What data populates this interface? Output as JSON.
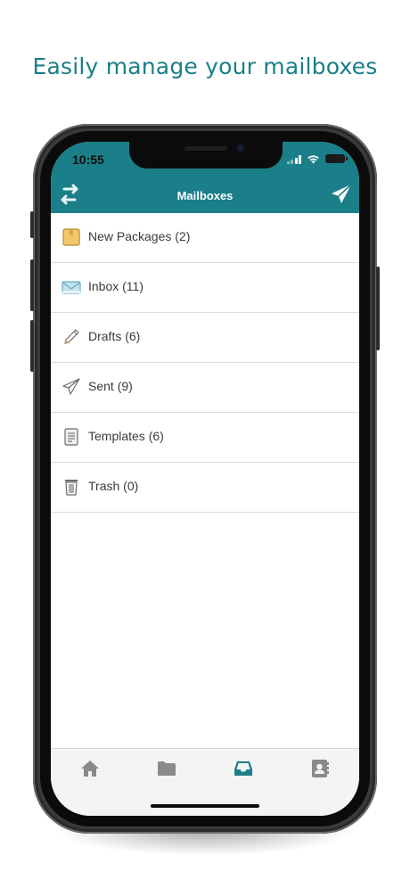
{
  "headline": "Easily manage your mailboxes",
  "status_bar": {
    "time": "10:55"
  },
  "nav": {
    "title": "Mailboxes",
    "left_icon": "switch-arrows-icon",
    "right_icon": "send-paper-plane-icon"
  },
  "mailboxes": [
    {
      "label": "New Packages (2)",
      "icon": "package-icon"
    },
    {
      "label": "Inbox (11)",
      "icon": "inbox-envelope-icon"
    },
    {
      "label": "Drafts (6)",
      "icon": "pencil-icon"
    },
    {
      "label": "Sent (9)",
      "icon": "paper-plane-icon"
    },
    {
      "label": "Templates (6)",
      "icon": "document-icon"
    },
    {
      "label": "Trash (0)",
      "icon": "trash-icon"
    }
  ],
  "tabbar": {
    "tabs": [
      {
        "icon": "home-icon",
        "active": false
      },
      {
        "icon": "folder-icon",
        "active": false
      },
      {
        "icon": "inbox-tray-icon",
        "active": true
      },
      {
        "icon": "contacts-icon",
        "active": false
      }
    ]
  },
  "colors": {
    "accent": "#1a7f88",
    "inactive_icon": "#8a8a8a",
    "row_text": "#3a3a3a"
  }
}
